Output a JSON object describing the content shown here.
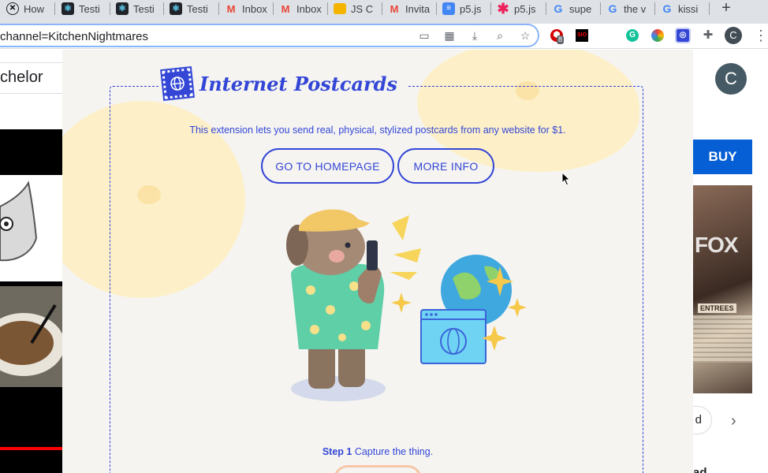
{
  "browser": {
    "tabs": [
      {
        "title": "How",
        "icon": "x-circle-icon"
      },
      {
        "title": "Testi",
        "icon": "react-icon"
      },
      {
        "title": "Testi",
        "icon": "react-icon"
      },
      {
        "title": "Testi",
        "icon": "react-icon"
      },
      {
        "title": "Inbox",
        "icon": "gmail-icon"
      },
      {
        "title": "Inbox",
        "icon": "gmail-icon"
      },
      {
        "title": "JS C",
        "icon": "slides-icon"
      },
      {
        "title": "Invita",
        "icon": "gmail-icon"
      },
      {
        "title": "p5.js",
        "icon": "docs-icon"
      },
      {
        "title": "p5.js",
        "icon": "asterisk-icon"
      },
      {
        "title": "supe",
        "icon": "google-icon"
      },
      {
        "title": "the v",
        "icon": "google-icon"
      },
      {
        "title": "kissi",
        "icon": "google-icon"
      }
    ],
    "new_tab_label": "+",
    "url": "channel=KitchenNightmares",
    "extension_badge_count": "8",
    "ext_sio_label": "SIO",
    "profile_initial": "C",
    "menu_label": "⋮"
  },
  "left_page": {
    "title_fragment": "chelor"
  },
  "right_page": {
    "avatar_initial": "C",
    "buy_label": "BUY",
    "image_watermark": "FOX",
    "image_heading": "ENTREES",
    "chip_label": "d",
    "next_arrow": "›"
  },
  "popup": {
    "brand_name": "Internet Postcards",
    "tagline": "This extension lets you send real, physical, stylized postcards from any website for $1.",
    "homepage_button": "GO TO HOMEPAGE",
    "more_info_button": "MORE INFO",
    "step_number": "Step 1",
    "step_text": "Capture the thing.",
    "colors": {
      "accent": "#3346d6",
      "background": "#f5f4f1",
      "blob": "#fdf0c8"
    }
  }
}
